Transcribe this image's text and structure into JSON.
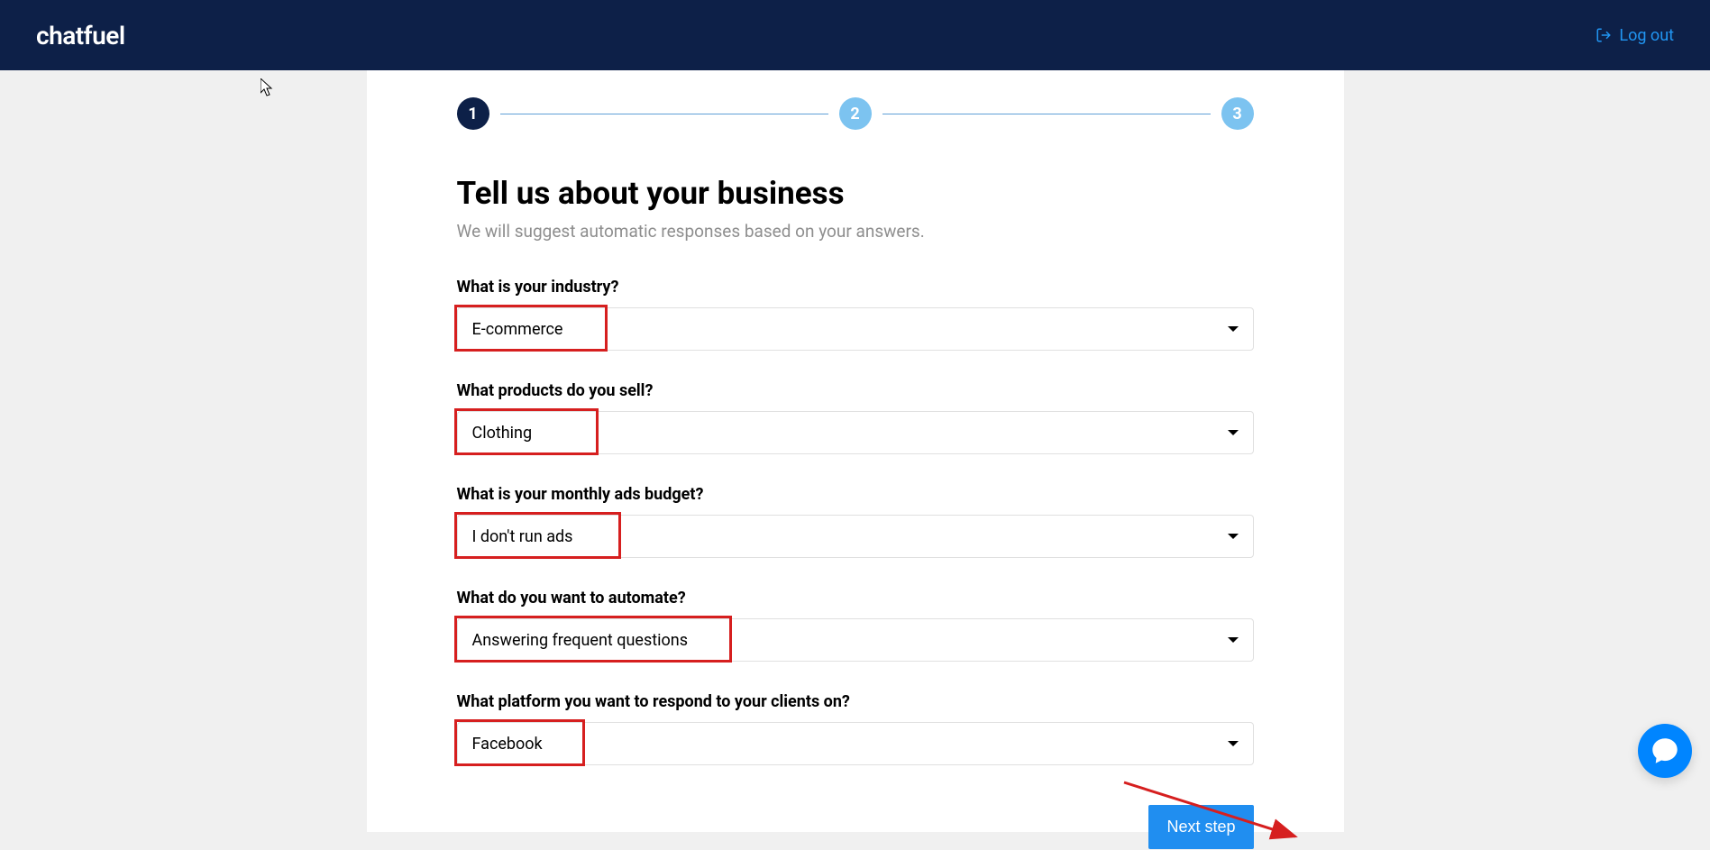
{
  "header": {
    "logo_text": "chatfuel",
    "logout_label": "Log out"
  },
  "stepper": {
    "step1": "1",
    "step2": "2",
    "step3": "3",
    "current_step": 1
  },
  "page": {
    "title": "Tell us about your business",
    "subtitle": "We will suggest automatic responses based on your answers."
  },
  "form": {
    "industry": {
      "label": "What is your industry?",
      "value": "E-commerce"
    },
    "products": {
      "label": "What products do you sell?",
      "value": "Clothing"
    },
    "budget": {
      "label": "What is your monthly ads budget?",
      "value": "I don't run ads"
    },
    "automate": {
      "label": "What do you want to automate?",
      "value": "Answering frequent questions"
    },
    "platform": {
      "label": "What platform you want to respond to your clients on?",
      "value": "Facebook"
    }
  },
  "buttons": {
    "next_step": "Next step"
  }
}
